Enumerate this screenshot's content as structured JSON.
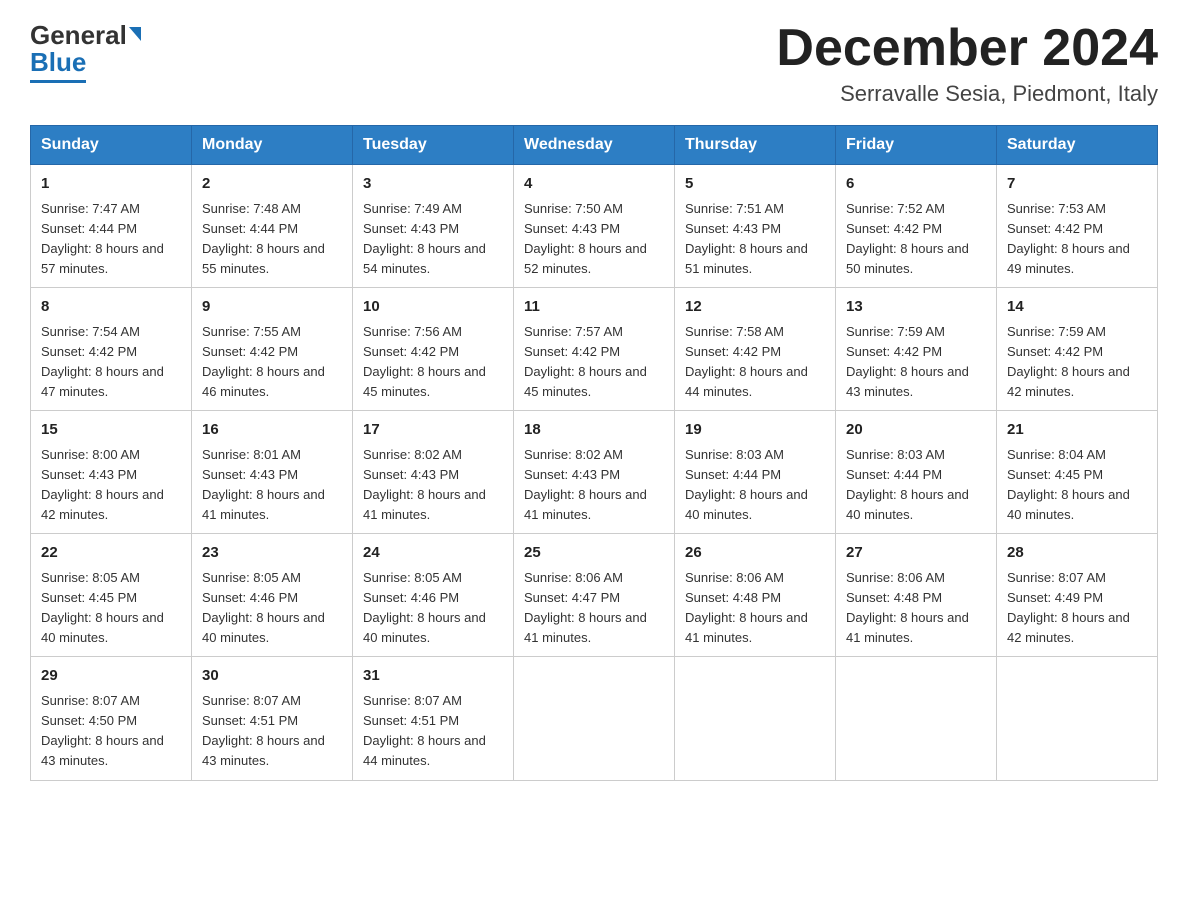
{
  "logo": {
    "general": "General",
    "blue": "Blue"
  },
  "header": {
    "month_year": "December 2024",
    "location": "Serravalle Sesia, Piedmont, Italy"
  },
  "weekdays": [
    "Sunday",
    "Monday",
    "Tuesday",
    "Wednesday",
    "Thursday",
    "Friday",
    "Saturday"
  ],
  "weeks": [
    [
      {
        "day": "1",
        "sunrise": "Sunrise: 7:47 AM",
        "sunset": "Sunset: 4:44 PM",
        "daylight": "Daylight: 8 hours and 57 minutes."
      },
      {
        "day": "2",
        "sunrise": "Sunrise: 7:48 AM",
        "sunset": "Sunset: 4:44 PM",
        "daylight": "Daylight: 8 hours and 55 minutes."
      },
      {
        "day": "3",
        "sunrise": "Sunrise: 7:49 AM",
        "sunset": "Sunset: 4:43 PM",
        "daylight": "Daylight: 8 hours and 54 minutes."
      },
      {
        "day": "4",
        "sunrise": "Sunrise: 7:50 AM",
        "sunset": "Sunset: 4:43 PM",
        "daylight": "Daylight: 8 hours and 52 minutes."
      },
      {
        "day": "5",
        "sunrise": "Sunrise: 7:51 AM",
        "sunset": "Sunset: 4:43 PM",
        "daylight": "Daylight: 8 hours and 51 minutes."
      },
      {
        "day": "6",
        "sunrise": "Sunrise: 7:52 AM",
        "sunset": "Sunset: 4:42 PM",
        "daylight": "Daylight: 8 hours and 50 minutes."
      },
      {
        "day": "7",
        "sunrise": "Sunrise: 7:53 AM",
        "sunset": "Sunset: 4:42 PM",
        "daylight": "Daylight: 8 hours and 49 minutes."
      }
    ],
    [
      {
        "day": "8",
        "sunrise": "Sunrise: 7:54 AM",
        "sunset": "Sunset: 4:42 PM",
        "daylight": "Daylight: 8 hours and 47 minutes."
      },
      {
        "day": "9",
        "sunrise": "Sunrise: 7:55 AM",
        "sunset": "Sunset: 4:42 PM",
        "daylight": "Daylight: 8 hours and 46 minutes."
      },
      {
        "day": "10",
        "sunrise": "Sunrise: 7:56 AM",
        "sunset": "Sunset: 4:42 PM",
        "daylight": "Daylight: 8 hours and 45 minutes."
      },
      {
        "day": "11",
        "sunrise": "Sunrise: 7:57 AM",
        "sunset": "Sunset: 4:42 PM",
        "daylight": "Daylight: 8 hours and 45 minutes."
      },
      {
        "day": "12",
        "sunrise": "Sunrise: 7:58 AM",
        "sunset": "Sunset: 4:42 PM",
        "daylight": "Daylight: 8 hours and 44 minutes."
      },
      {
        "day": "13",
        "sunrise": "Sunrise: 7:59 AM",
        "sunset": "Sunset: 4:42 PM",
        "daylight": "Daylight: 8 hours and 43 minutes."
      },
      {
        "day": "14",
        "sunrise": "Sunrise: 7:59 AM",
        "sunset": "Sunset: 4:42 PM",
        "daylight": "Daylight: 8 hours and 42 minutes."
      }
    ],
    [
      {
        "day": "15",
        "sunrise": "Sunrise: 8:00 AM",
        "sunset": "Sunset: 4:43 PM",
        "daylight": "Daylight: 8 hours and 42 minutes."
      },
      {
        "day": "16",
        "sunrise": "Sunrise: 8:01 AM",
        "sunset": "Sunset: 4:43 PM",
        "daylight": "Daylight: 8 hours and 41 minutes."
      },
      {
        "day": "17",
        "sunrise": "Sunrise: 8:02 AM",
        "sunset": "Sunset: 4:43 PM",
        "daylight": "Daylight: 8 hours and 41 minutes."
      },
      {
        "day": "18",
        "sunrise": "Sunrise: 8:02 AM",
        "sunset": "Sunset: 4:43 PM",
        "daylight": "Daylight: 8 hours and 41 minutes."
      },
      {
        "day": "19",
        "sunrise": "Sunrise: 8:03 AM",
        "sunset": "Sunset: 4:44 PM",
        "daylight": "Daylight: 8 hours and 40 minutes."
      },
      {
        "day": "20",
        "sunrise": "Sunrise: 8:03 AM",
        "sunset": "Sunset: 4:44 PM",
        "daylight": "Daylight: 8 hours and 40 minutes."
      },
      {
        "day": "21",
        "sunrise": "Sunrise: 8:04 AM",
        "sunset": "Sunset: 4:45 PM",
        "daylight": "Daylight: 8 hours and 40 minutes."
      }
    ],
    [
      {
        "day": "22",
        "sunrise": "Sunrise: 8:05 AM",
        "sunset": "Sunset: 4:45 PM",
        "daylight": "Daylight: 8 hours and 40 minutes."
      },
      {
        "day": "23",
        "sunrise": "Sunrise: 8:05 AM",
        "sunset": "Sunset: 4:46 PM",
        "daylight": "Daylight: 8 hours and 40 minutes."
      },
      {
        "day": "24",
        "sunrise": "Sunrise: 8:05 AM",
        "sunset": "Sunset: 4:46 PM",
        "daylight": "Daylight: 8 hours and 40 minutes."
      },
      {
        "day": "25",
        "sunrise": "Sunrise: 8:06 AM",
        "sunset": "Sunset: 4:47 PM",
        "daylight": "Daylight: 8 hours and 41 minutes."
      },
      {
        "day": "26",
        "sunrise": "Sunrise: 8:06 AM",
        "sunset": "Sunset: 4:48 PM",
        "daylight": "Daylight: 8 hours and 41 minutes."
      },
      {
        "day": "27",
        "sunrise": "Sunrise: 8:06 AM",
        "sunset": "Sunset: 4:48 PM",
        "daylight": "Daylight: 8 hours and 41 minutes."
      },
      {
        "day": "28",
        "sunrise": "Sunrise: 8:07 AM",
        "sunset": "Sunset: 4:49 PM",
        "daylight": "Daylight: 8 hours and 42 minutes."
      }
    ],
    [
      {
        "day": "29",
        "sunrise": "Sunrise: 8:07 AM",
        "sunset": "Sunset: 4:50 PM",
        "daylight": "Daylight: 8 hours and 43 minutes."
      },
      {
        "day": "30",
        "sunrise": "Sunrise: 8:07 AM",
        "sunset": "Sunset: 4:51 PM",
        "daylight": "Daylight: 8 hours and 43 minutes."
      },
      {
        "day": "31",
        "sunrise": "Sunrise: 8:07 AM",
        "sunset": "Sunset: 4:51 PM",
        "daylight": "Daylight: 8 hours and 44 minutes."
      },
      null,
      null,
      null,
      null
    ]
  ]
}
